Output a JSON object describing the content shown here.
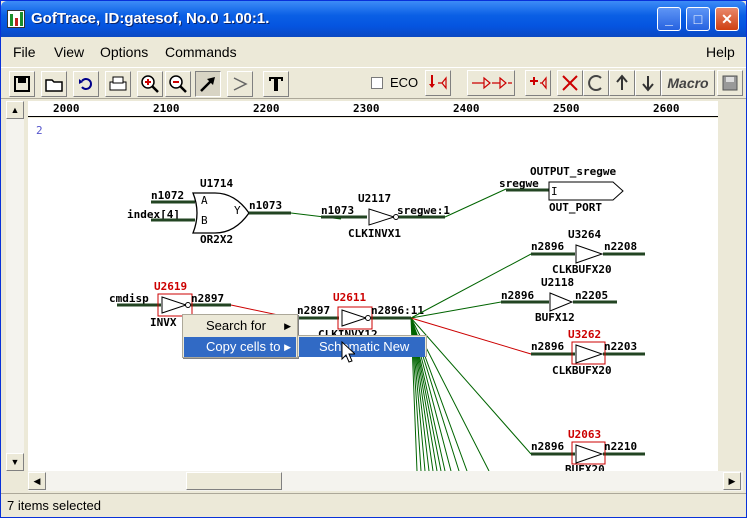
{
  "window": {
    "title": "GofTrace, ID:gatesof, No.0 1.00:1.",
    "minimize": "_",
    "maximize": "□",
    "close": "✕"
  },
  "menu": {
    "file": "File",
    "view": "View",
    "options": "Options",
    "commands": "Commands",
    "help": "Help"
  },
  "toolbar": {
    "eco": "ECO",
    "macro": "Macro",
    "icons": [
      "save-icon",
      "open-icon",
      "undo-icon",
      "print-icon",
      "zoom-in-icon",
      "zoom-out-icon",
      "select-arrow-icon",
      "draw-arrow-icon",
      "text-icon",
      "trace-input-icon",
      "trace-through-icon",
      "add-icon",
      "delete-icon",
      "refresh-icon",
      "up-icon",
      "down-icon",
      "disk-icon"
    ]
  },
  "ruler": {
    "labels": [
      "2000",
      "2100",
      "2200",
      "2300",
      "2400",
      "2500",
      "2600"
    ]
  },
  "canvas": {
    "sheet_num": "2",
    "labels": {
      "u1714": "U1714",
      "n1072": "n1072",
      "index4": "index[4]",
      "pin_a": "A",
      "pin_b": "B",
      "pin_y": "Y",
      "n1073a": "n1073",
      "or2x2": "OR2X2",
      "u2117": "U2117",
      "n1073b": "n1073",
      "sregwe1": "sregwe:1",
      "clkinvx1": "CLKINVX1",
      "output_sregwe": "OUTPUT_sregwe",
      "sregwe": "sregwe",
      "pin_i": "I",
      "out_port": "OUT_PORT",
      "u3264": "U3264",
      "n2896a": "n2896",
      "n2208": "n2208",
      "clkbufx20a": "CLKBUFX20",
      "u2118": "U2118",
      "n2896b": "n2896",
      "n2205": "n2205",
      "bufx12": "BUFX12",
      "u3262": "U3262",
      "n2896c": "n2896",
      "n2203": "n2203",
      "clkbufx20b": "CLKBUFX20",
      "u2063": "U2063",
      "n2896d": "n2896",
      "n2210": "n2210",
      "bufx20": "BUFX20",
      "u2619": "U2619",
      "cmdisp": "cmdisp",
      "n2897a": "n2897",
      "invx": "INVX",
      "u2611": "U2611",
      "n2897b": "n2897",
      "n2896_11": "n2896:11",
      "clkinvx12": "CLKINVX12"
    }
  },
  "context_menu": {
    "search_for": "Search for",
    "copy_cells_to": "Copy cells to",
    "schematic_new": "Schematic New"
  },
  "status": {
    "text": "7 items selected"
  },
  "colors": {
    "wire": "#006400",
    "selected": "#cc0000",
    "net": "#224422",
    "highlight": "#316ac5"
  }
}
